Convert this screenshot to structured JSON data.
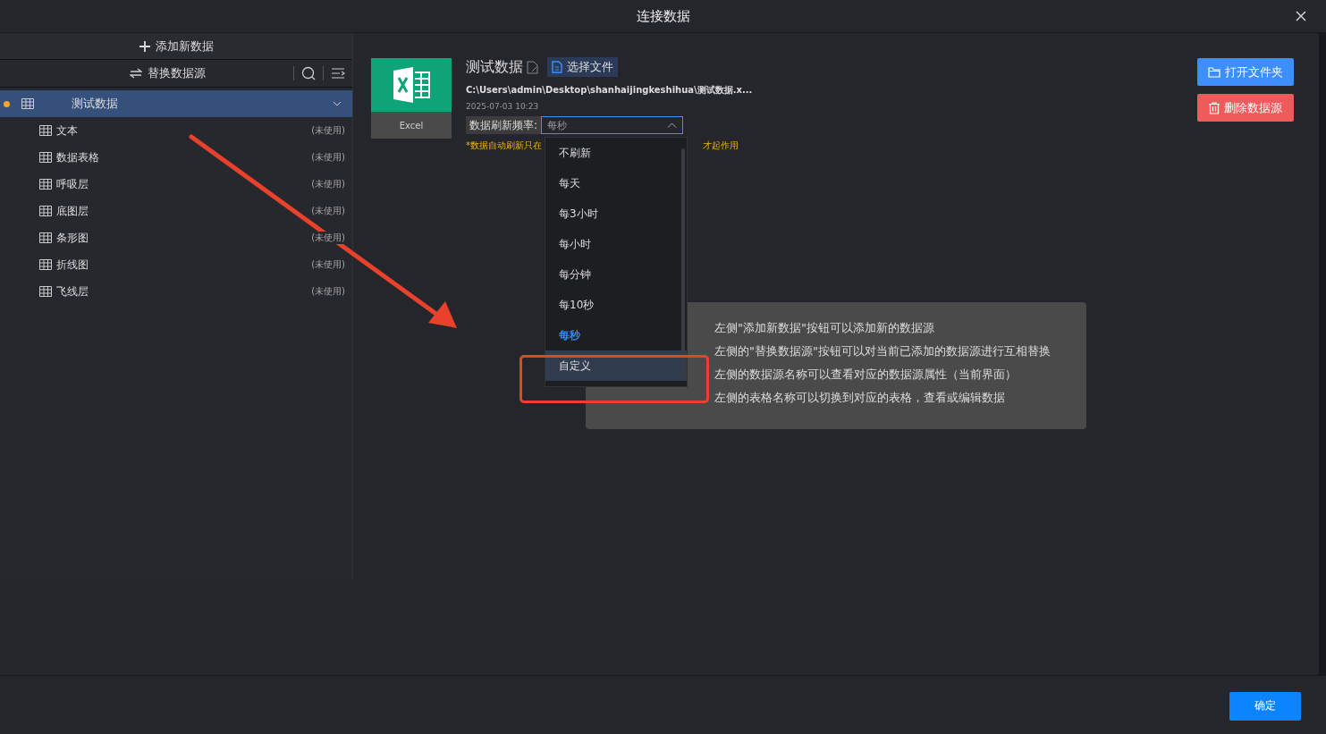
{
  "window": {
    "title": "连接数据"
  },
  "sidebar": {
    "add_button": "添加新数据",
    "swap_button": "替换数据源",
    "source": {
      "name": "测试数据",
      "selected": true,
      "expanded": true,
      "children": [
        {
          "name": "文本",
          "status": "(未使用)"
        },
        {
          "name": "数据表格",
          "status": "(未使用)"
        },
        {
          "name": "呼吸层",
          "status": "(未使用)"
        },
        {
          "name": "底图层",
          "status": "(未使用)"
        },
        {
          "name": "条形图",
          "status": "(未使用)"
        },
        {
          "name": "折线图",
          "status": "(未使用)"
        },
        {
          "name": "飞线层",
          "status": "(未使用)"
        }
      ]
    }
  },
  "detail": {
    "file_type": "Excel",
    "name": "测试数据",
    "choose_file_button": "选择文件",
    "path": "C:\\Users\\admin\\Desktop\\shanhaijingkeshihua\\测试数据.x...",
    "date": "2025-07-03 10:23",
    "refresh_label": "数据刷新频率:",
    "refresh_value": "每秒",
    "dropdown_open": true,
    "warning_start": "*数据自动刷新只在",
    "warning_end": "才起作用",
    "open_folder_button": "打开文件夹",
    "delete_button": "删除数据源"
  },
  "refresh_options": [
    {
      "label": "不刷新",
      "selected": false,
      "hovered": false
    },
    {
      "label": "每天",
      "selected": false,
      "hovered": false
    },
    {
      "label": "每3小时",
      "selected": false,
      "hovered": false
    },
    {
      "label": "每小时",
      "selected": false,
      "hovered": false
    },
    {
      "label": "每分钟",
      "selected": false,
      "hovered": false
    },
    {
      "label": "每10秒",
      "selected": false,
      "hovered": false
    },
    {
      "label": "每秒",
      "selected": true,
      "hovered": false
    },
    {
      "label": "自定义",
      "selected": false,
      "hovered": true
    }
  ],
  "hints": [
    "左侧\"添加新数据\"按钮可以添加新的数据源",
    "左侧的\"替换数据源\"按钮可以对当前已添加的数据源进行互相替换",
    "左侧的数据源名称可以查看对应的数据源属性（当前界面）",
    "左侧的表格名称可以切换到对应的表格，查看或编辑数据"
  ],
  "annotations": {
    "arrow": true,
    "highlight_box": true
  },
  "footer": {
    "confirm_button": "确定"
  }
}
